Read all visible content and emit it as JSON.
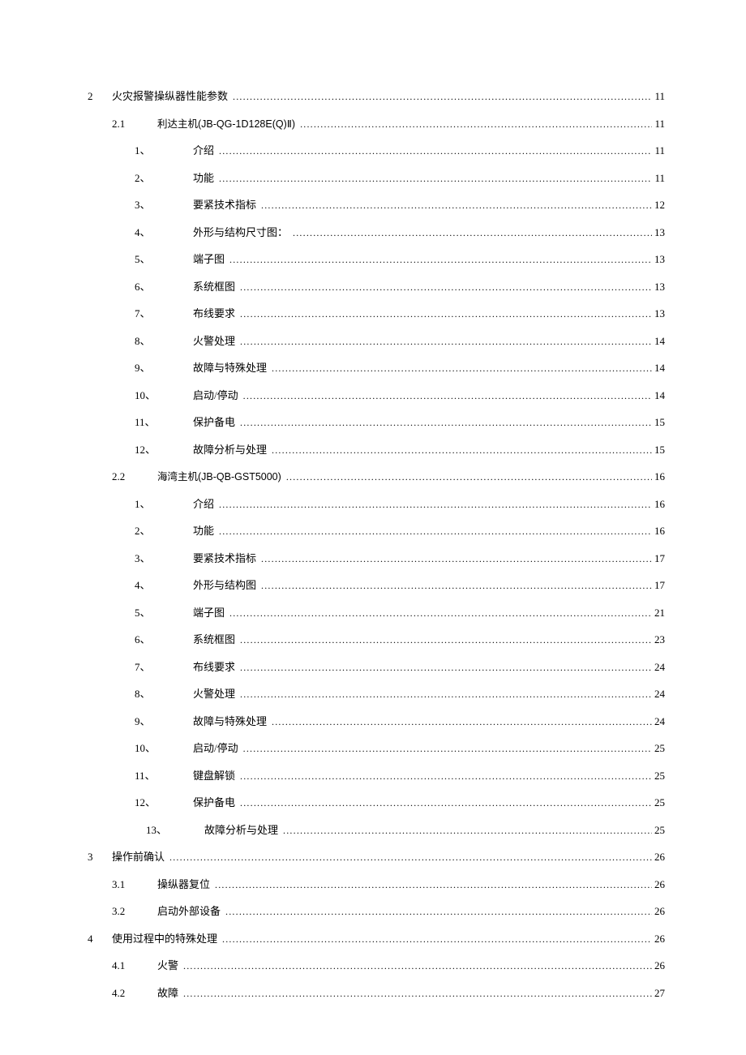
{
  "toc": [
    {
      "lvl": 1,
      "num": "2",
      "label": "火灾报警操纵器性能参数",
      "page": "11",
      "labelPad": 0
    },
    {
      "lvl": 2,
      "num": "2.1",
      "label": "利达主机(JB-QG-1D128E(Q)Ⅱ)",
      "page": "11",
      "latin": true
    },
    {
      "lvl": 3,
      "num": "1、",
      "label": "介绍",
      "page": "11"
    },
    {
      "lvl": 3,
      "num": "2、",
      "label": "功能",
      "page": "11"
    },
    {
      "lvl": 3,
      "num": "3、",
      "label": "要紧技术指标",
      "page": "12"
    },
    {
      "lvl": 3,
      "num": "4、",
      "label": "外形与结构尺寸图：",
      "page": "13"
    },
    {
      "lvl": 3,
      "num": "5、",
      "label": "端子图",
      "page": "13"
    },
    {
      "lvl": 3,
      "num": "6、",
      "label": "系统框图",
      "page": "13"
    },
    {
      "lvl": 3,
      "num": "7、",
      "label": "布线要求",
      "page": "13"
    },
    {
      "lvl": 3,
      "num": "8、",
      "label": "火警处理",
      "page": "14"
    },
    {
      "lvl": 3,
      "num": "9、",
      "label": "故障与特殊处理",
      "page": "14"
    },
    {
      "lvl": 3,
      "num": "10、",
      "label": "启动/停动",
      "page": "14"
    },
    {
      "lvl": 3,
      "num": "11、",
      "label": "保护备电",
      "page": "15"
    },
    {
      "lvl": 3,
      "num": "12、",
      "label": "故障分析与处理",
      "page": "15"
    },
    {
      "lvl": 2,
      "num": "2.2",
      "label": "海湾主机(JB-QB-GST5000)",
      "page": "16",
      "latin": true
    },
    {
      "lvl": 3,
      "num": "1、",
      "label": "介绍",
      "page": "16"
    },
    {
      "lvl": 3,
      "num": "2、",
      "label": "功能",
      "page": "16"
    },
    {
      "lvl": 3,
      "num": "3、",
      "label": "要紧技术指标",
      "page": "17"
    },
    {
      "lvl": 3,
      "num": "4、",
      "label": "外形与结构图",
      "page": "17"
    },
    {
      "lvl": 3,
      "num": "5、",
      "label": "端子图",
      "page": "21"
    },
    {
      "lvl": 3,
      "num": "6、",
      "label": "系统框图",
      "page": "23"
    },
    {
      "lvl": 3,
      "num": "7、",
      "label": "布线要求",
      "page": "24"
    },
    {
      "lvl": 3,
      "num": "8、",
      "label": "火警处理",
      "page": "24"
    },
    {
      "lvl": 3,
      "num": "9、",
      "label": "故障与特殊处理",
      "page": "24"
    },
    {
      "lvl": 3,
      "num": "10、",
      "label": "启动/停动",
      "page": "25"
    },
    {
      "lvl": 3,
      "num": "11、",
      "label": "键盘解锁",
      "page": "25"
    },
    {
      "lvl": 3,
      "num": "12、",
      "label": "保护备电",
      "page": "25"
    },
    {
      "lvl": 3,
      "num": "13、",
      "label": "故障分析与处理",
      "page": "25",
      "extraIndent": 14
    },
    {
      "lvl": 1,
      "num": "3",
      "label": "操作前确认",
      "page": "26"
    },
    {
      "lvl": 2,
      "num": "3.1",
      "label": "操纵器复位",
      "page": "26"
    },
    {
      "lvl": 2,
      "num": "3.2",
      "label": "启动外部设备",
      "page": "26"
    },
    {
      "lvl": 1,
      "num": "4",
      "label": "使用过程中的特殊处理",
      "page": "26"
    },
    {
      "lvl": 2,
      "num": "4.1",
      "label": "火警",
      "page": "26"
    },
    {
      "lvl": 2,
      "num": "4.2",
      "label": "故障",
      "page": "27"
    }
  ]
}
